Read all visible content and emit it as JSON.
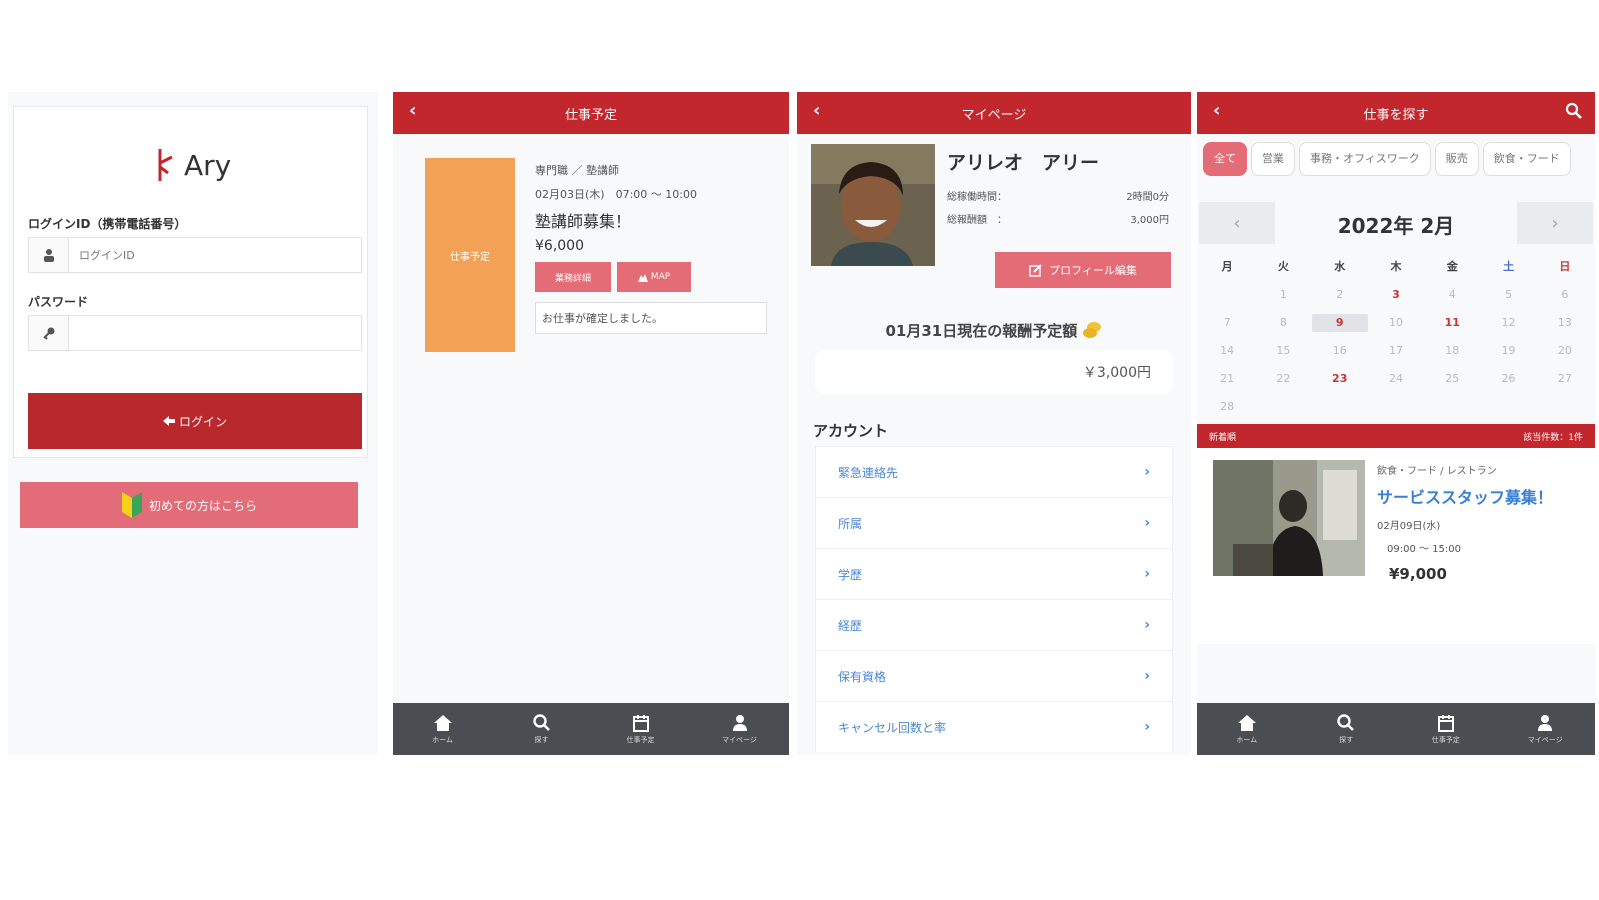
{
  "login": {
    "logo_text": "Ary",
    "id_label": "ログインID（携帯電話番号）",
    "id_placeholder": "ログインID",
    "password_label": "パスワード",
    "login_button": "ログイン",
    "first_button": "初めての方はこちら"
  },
  "schedule": {
    "header": "仕事予定",
    "badge": "仕事予定",
    "category": "専門職 ／ 塾講師",
    "datetime": "02月03日(木)　07:00 〜 10:00",
    "title": "塾講師募集！",
    "pay": "¥6,000",
    "detail_button": "業務詳細",
    "map_button": "MAP",
    "message": "お仕事が確定しました。"
  },
  "mypage": {
    "header": "マイページ",
    "name": "アリレオ　アリー",
    "stats": [
      {
        "label": "総稼働時間：",
        "value": "2時間0分"
      },
      {
        "label": "総報酬額　：",
        "value": "3,000円"
      }
    ],
    "edit_button": "プロフィール編集",
    "reward_title": "01月31日現在の報酬予定額",
    "reward_value": "￥3,000円",
    "account_title": "アカウント",
    "account_items": [
      "緊急連絡先",
      "所属",
      "学歴",
      "経歴",
      "保有資格",
      "キャンセル回数と率"
    ]
  },
  "search": {
    "header": "仕事を探す",
    "chips": [
      "全て",
      "営業",
      "事務・オフィスワーク",
      "販売",
      "飲食・フード"
    ],
    "cal_title": "2022年 2月",
    "weekdays": [
      "月",
      "火",
      "水",
      "木",
      "金",
      "土",
      "日"
    ],
    "days": [
      "",
      "1",
      "2",
      "3",
      "4",
      "5",
      "6",
      "7",
      "8",
      "9",
      "10",
      "11",
      "12",
      "13",
      "14",
      "15",
      "16",
      "17",
      "18",
      "19",
      "20",
      "21",
      "22",
      "23",
      "24",
      "25",
      "26",
      "27",
      "28"
    ],
    "list_left": "新着順",
    "list_right": "該当件数：1件",
    "job": {
      "category": "飲食・フード / レストラン",
      "title": "サービススタッフ募集！",
      "date": "02月09日(水)",
      "time": "09:00 〜 15:00",
      "pay": "¥9,000"
    }
  },
  "tabbar": [
    "ホーム",
    "探す",
    "仕事予定",
    "マイページ"
  ],
  "colors": {
    "brand_red": "#c1272d",
    "pink": "#e46c77",
    "orange": "#f2a155",
    "tabbar": "#4a4d52",
    "link_blue": "#4a86d8"
  }
}
